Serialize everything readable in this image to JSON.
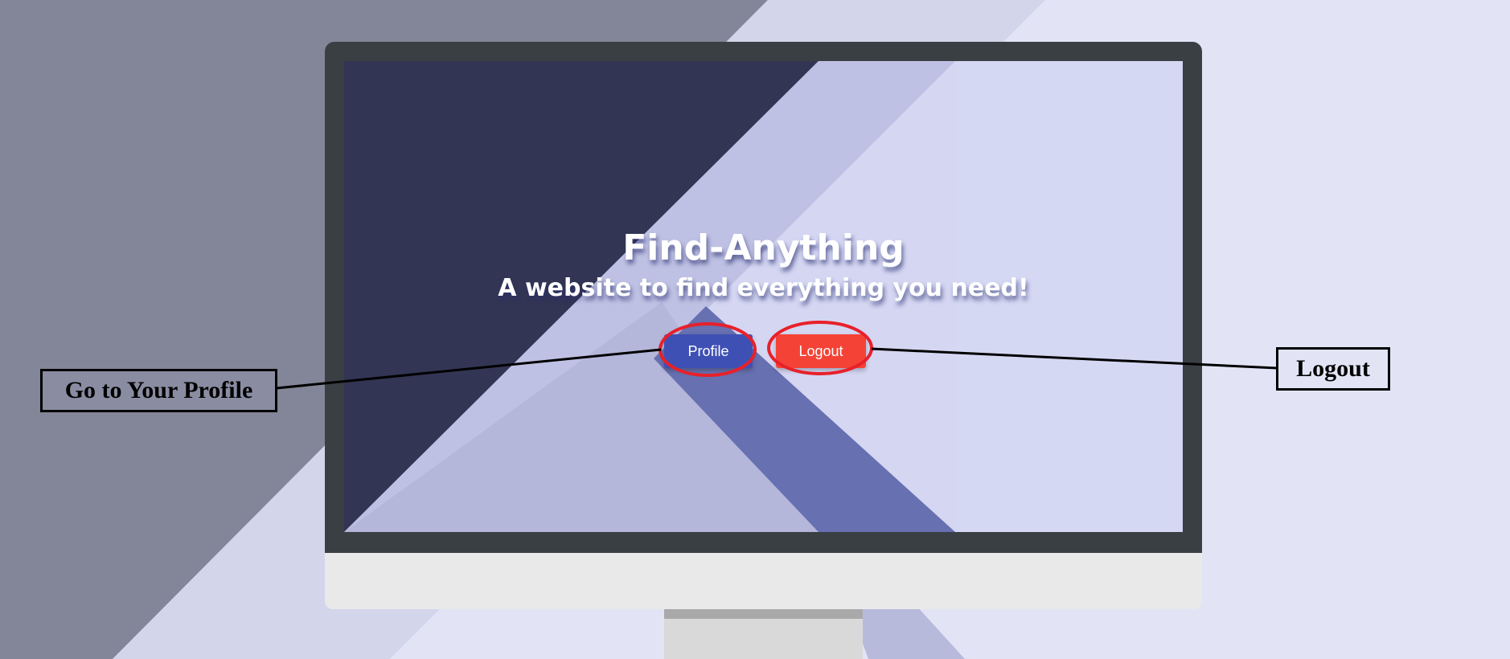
{
  "screen": {
    "title": "Find-Anything",
    "subtitle": "A website to find everything you need!",
    "profile_button_label": "Profile",
    "logout_button_label": "Logout"
  },
  "annotations": {
    "profile_callout": "Go to Your Profile",
    "logout_callout": "Logout"
  },
  "colors": {
    "profile_button": "#3f50b5",
    "logout_button": "#f44336",
    "highlight_ring": "#e8202a",
    "screen_dark": "#323553",
    "monitor_bezel": "#3a3f44"
  }
}
